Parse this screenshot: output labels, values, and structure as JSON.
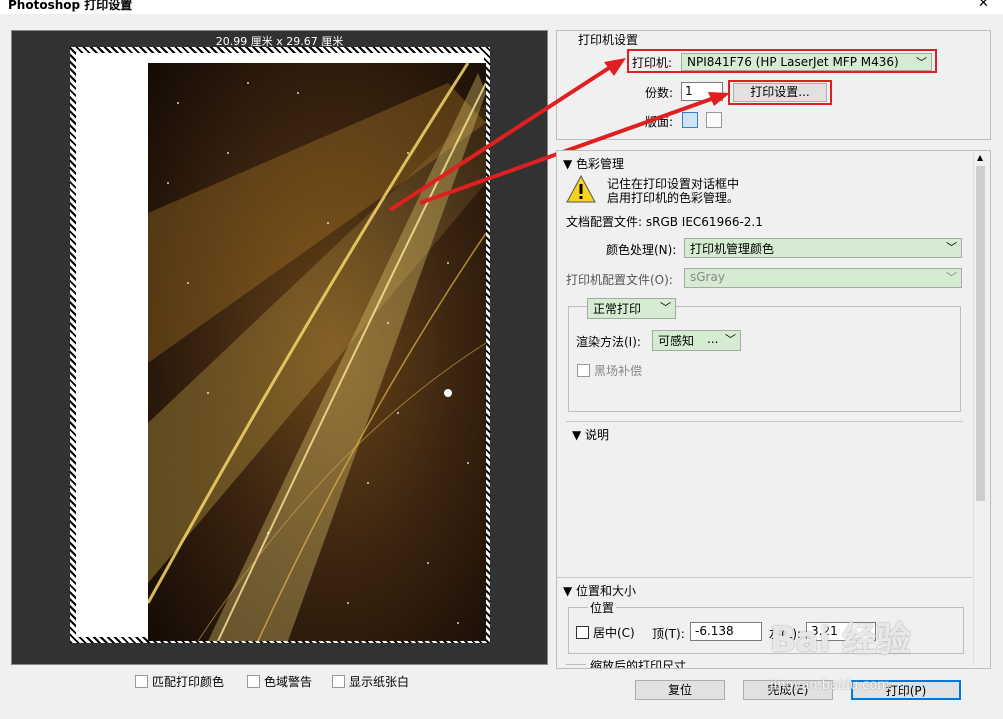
{
  "window": {
    "title": "Photoshop 打印设置",
    "close": "✕"
  },
  "preview": {
    "paper_size": "20.99 厘米 x 29.67 厘米",
    "options": [
      "匹配打印颜色",
      "色域警告",
      "显示纸张白"
    ]
  },
  "printer_settings": {
    "heading": "打印机设置",
    "printer_label": "打印机:",
    "printer_value": "NPI841F76 (HP LaserJet MFP M436)",
    "copies_label": "份数:",
    "copies_value": "1",
    "print_settings_button": "打印设置...",
    "layout_label": "版面:"
  },
  "color_management": {
    "heading": "色彩管理",
    "warning_line1": "记住在打印设置对话框中",
    "warning_line2": "启用打印机的色彩管理。",
    "doc_profile": "文档配置文件: sRGB IEC61966-2.1",
    "color_handling_label": "颜色处理(N):",
    "color_handling_value": "打印机管理颜色",
    "printer_profile_label": "打印机配置文件(O):",
    "printer_profile_value": "sGray",
    "print_mode": "正常打印",
    "render_label": "渲染方法(I):",
    "render_value": "可感知",
    "render_ellipsis": "...",
    "black_point": "黑场补偿"
  },
  "description": {
    "heading": "说明"
  },
  "position_size": {
    "heading": "位置和大小",
    "position_label": "位置",
    "center_label": "居中(C)",
    "top_label": "顶(T):",
    "top_value": "-6.138",
    "left_label": "左(L):",
    "left_value": "3.21",
    "scaled_label": "缩放后的打印尺寸"
  },
  "buttons": {
    "reset": "复位",
    "done": "完成(E)",
    "print": "打印(P)"
  },
  "watermark": {
    "logo": "Bai 经验",
    "url": "jingyan.baidu.com"
  },
  "colors": {
    "accent_red": "#e02020",
    "combo_bg": "#d6ecd2"
  }
}
